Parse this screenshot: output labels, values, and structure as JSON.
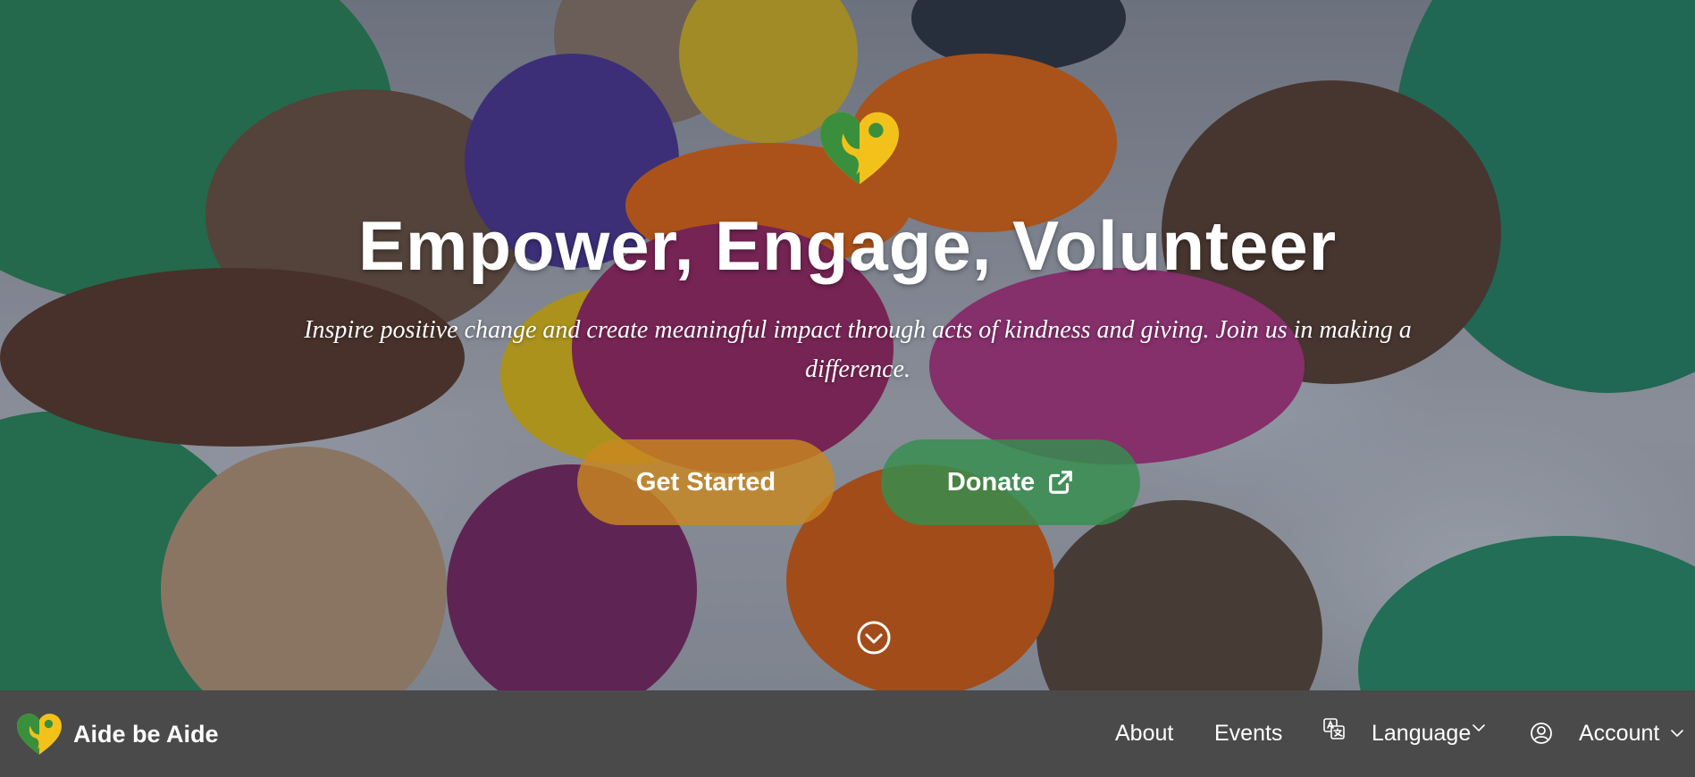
{
  "hero": {
    "headline": "Empower, Engage, Volunteer",
    "subheadline": "Inspire positive change and create meaningful impact through acts of kindness and giving. Join us in making a difference.",
    "buttons": {
      "get_started": "Get Started",
      "donate": "Donate"
    }
  },
  "navbar": {
    "brand_name": "Aide be Aide",
    "links": {
      "about": "About",
      "events": "Events",
      "language": "Language",
      "account": "Account"
    }
  },
  "colors": {
    "logo_green": "#3a8f3c",
    "logo_yellow": "#f2c21b",
    "button_start": "#c98720",
    "button_donate": "#348f4e",
    "navbar_bg": "#4a4a4a"
  },
  "icons": [
    "heart-logo-icon",
    "external-link-icon",
    "chevron-down-circle-icon",
    "translate-icon",
    "user-circle-icon",
    "chevron-down-icon"
  ]
}
